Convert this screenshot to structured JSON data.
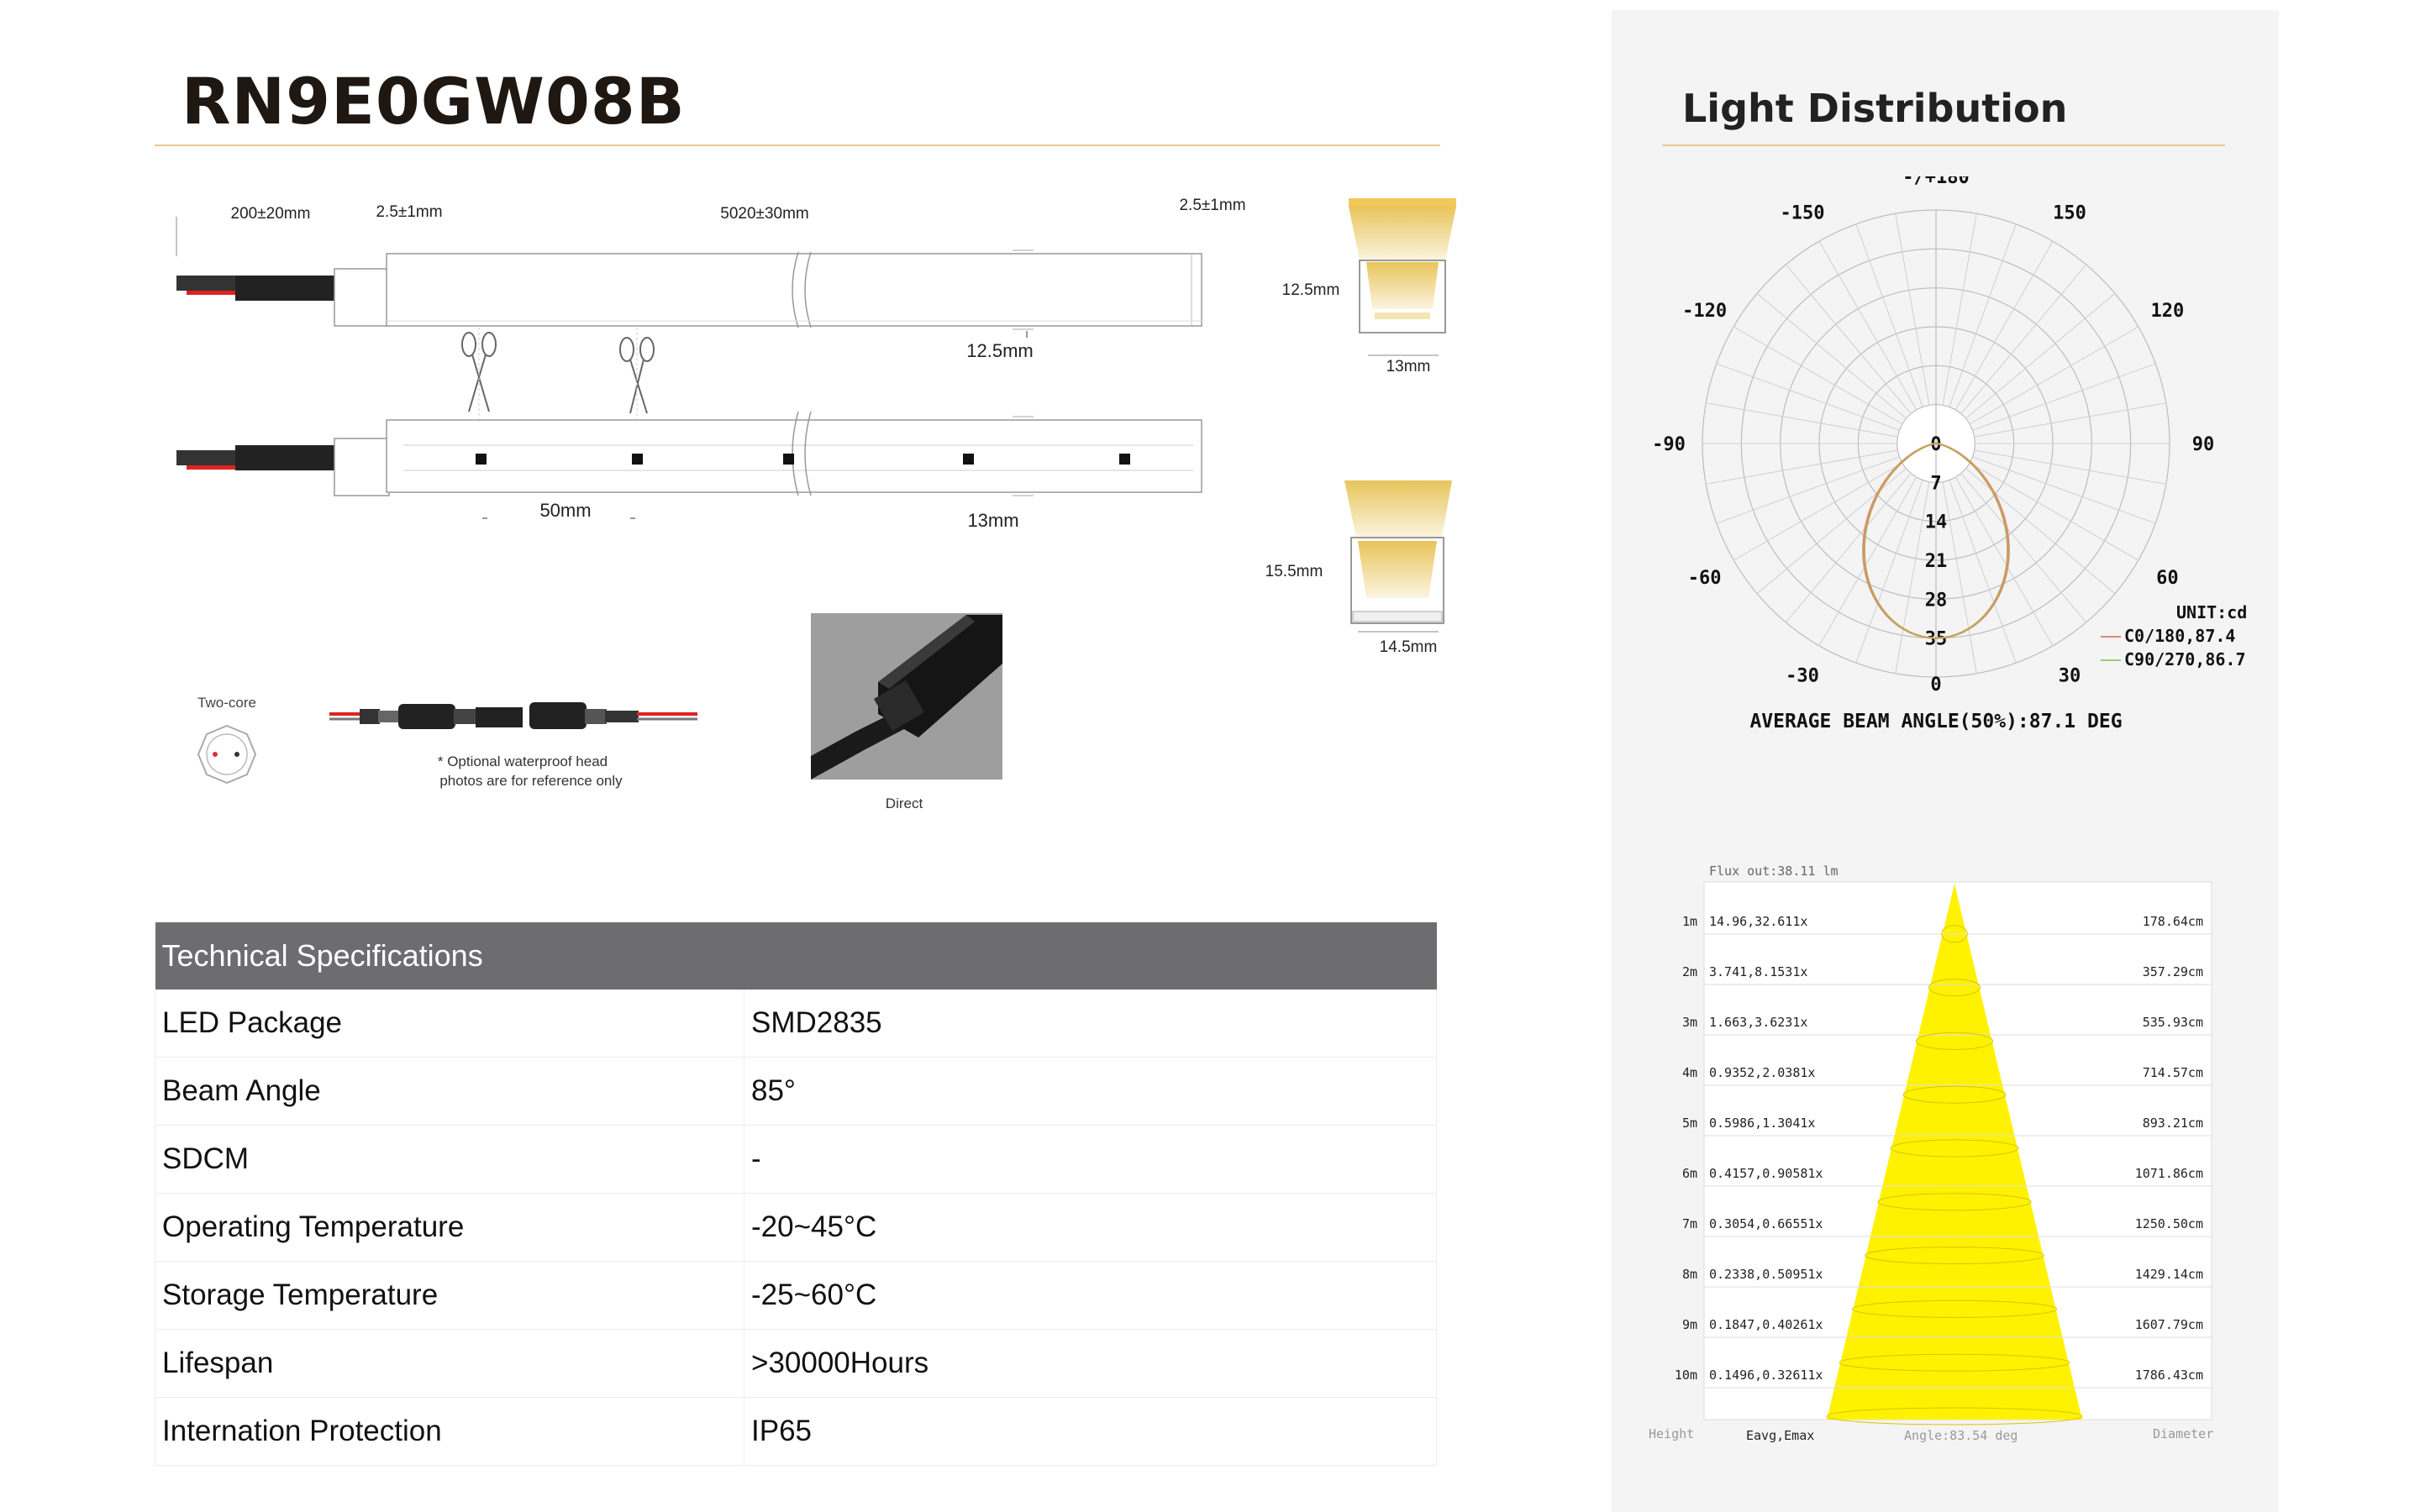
{
  "product": {
    "title": "RN9E0GW08B"
  },
  "drawing": {
    "dim_cable": "200±20mm",
    "dim_end_left": "2.5±1mm",
    "dim_length": "5020±30mm",
    "dim_end_right": "2.5±1mm",
    "height_label": "12.5mm",
    "width_label": "13mm",
    "cut_pitch": "50mm",
    "cross1_height": "12.5mm",
    "cross1_width": "13mm",
    "cross2_height": "15.5mm",
    "cross2_width": "14.5mm",
    "two_core_label": "Two-core",
    "waterproof_note_1": "* Optional waterproof head",
    "waterproof_note_2": "photos are for reference only",
    "photo_caption": "Direct"
  },
  "specs": {
    "header": "Technical Specifications",
    "rows": [
      {
        "label": "LED Package",
        "value": "SMD2835"
      },
      {
        "label": "Beam Angle",
        "value": "85°"
      },
      {
        "label": "SDCM",
        "value": "-"
      },
      {
        "label": "Operating Temperature",
        "value": "-20~45°C"
      },
      {
        "label": "Storage Temperature",
        "value": "-25~60°C"
      },
      {
        "label": "Lifespan",
        "value": ">30000Hours"
      },
      {
        "label": "Internation Protection",
        "value": "IP65"
      }
    ]
  },
  "light_distribution": {
    "title": "Light Distribution",
    "polar": {
      "angle_labels": [
        "-/+180",
        "-150",
        "150",
        "-120",
        "120",
        "-90",
        "90",
        "-60",
        "60",
        "-30",
        "30",
        "0"
      ],
      "radial_labels": [
        "0",
        "7",
        "14",
        "21",
        "28",
        "35"
      ],
      "unit": "UNIT:cd",
      "legend": [
        {
          "name": "C0/180,87.4",
          "color": "#e0877a"
        },
        {
          "name": "C90/270,86.7",
          "color": "#9acb7a"
        }
      ],
      "beam_angle_text": "AVERAGE BEAM ANGLE(50%):87.1 DEG"
    },
    "cone": {
      "flux": "Flux out:38.11 lm",
      "rows": [
        {
          "height": "1m",
          "lux": "14.96,32.611x",
          "diameter": "178.64cm"
        },
        {
          "height": "2m",
          "lux": "3.741,8.1531x",
          "diameter": "357.29cm"
        },
        {
          "height": "3m",
          "lux": "1.663,3.6231x",
          "diameter": "535.93cm"
        },
        {
          "height": "4m",
          "lux": "0.9352,2.0381x",
          "diameter": "714.57cm"
        },
        {
          "height": "5m",
          "lux": "0.5986,1.3041x",
          "diameter": "893.21cm"
        },
        {
          "height": "6m",
          "lux": "0.4157,0.90581x",
          "diameter": "1071.86cm"
        },
        {
          "height": "7m",
          "lux": "0.3054,0.66551x",
          "diameter": "1250.50cm"
        },
        {
          "height": "8m",
          "lux": "0.2338,0.50951x",
          "diameter": "1429.14cm"
        },
        {
          "height": "9m",
          "lux": "0.1847,0.40261x",
          "diameter": "1607.79cm"
        },
        {
          "height": "10m",
          "lux": "0.1496,0.32611x",
          "diameter": "1786.43cm"
        }
      ],
      "footer_height": "Height",
      "footer_eavg": "Eavg,Emax",
      "footer_angle": "Angle:83.54 deg",
      "footer_diameter": "Diameter",
      "fill_color": "#fff200"
    }
  }
}
